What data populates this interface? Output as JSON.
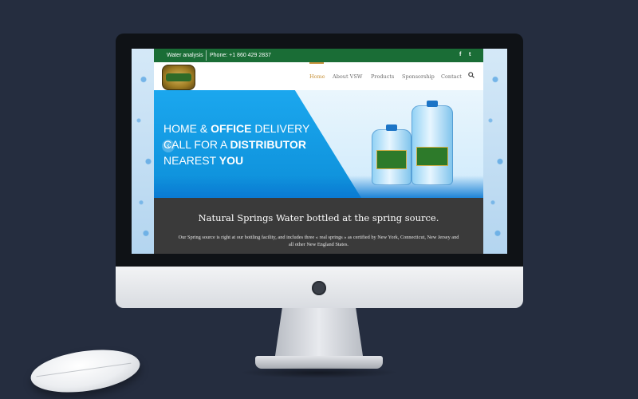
{
  "topbar": {
    "water_analysis": "Water analysis",
    "phone": "Phone: +1 860 429 2837",
    "social": [
      {
        "name": "facebook-icon",
        "glyph": "f"
      },
      {
        "name": "twitter-icon",
        "glyph": "t"
      }
    ],
    "color": "#1a6d36"
  },
  "nav": {
    "items": [
      "Home",
      "About VSW",
      "Products",
      "Sponsorship",
      "Contact"
    ],
    "active": "Home",
    "active_color": "#c7923a",
    "search_icon": "search-icon"
  },
  "hero": {
    "line1_a": "HOME & ",
    "line1_b": "OFFICE",
    "line1_c": " DELIVERY",
    "line2_a": "CALL FOR A ",
    "line2_b": "DISTRIBUTOR",
    "line3_a": "NEAREST ",
    "line3_b": "YOU",
    "arrow": "‹",
    "accent": "#1ba7ee"
  },
  "info": {
    "title": "Natural Springs Water bottled at the spring source.",
    "body": "Our Spring source is right at our bottling facility, and includes three « real springs » as certified by New York, Connecticut, New Jersey and all other New England States."
  }
}
